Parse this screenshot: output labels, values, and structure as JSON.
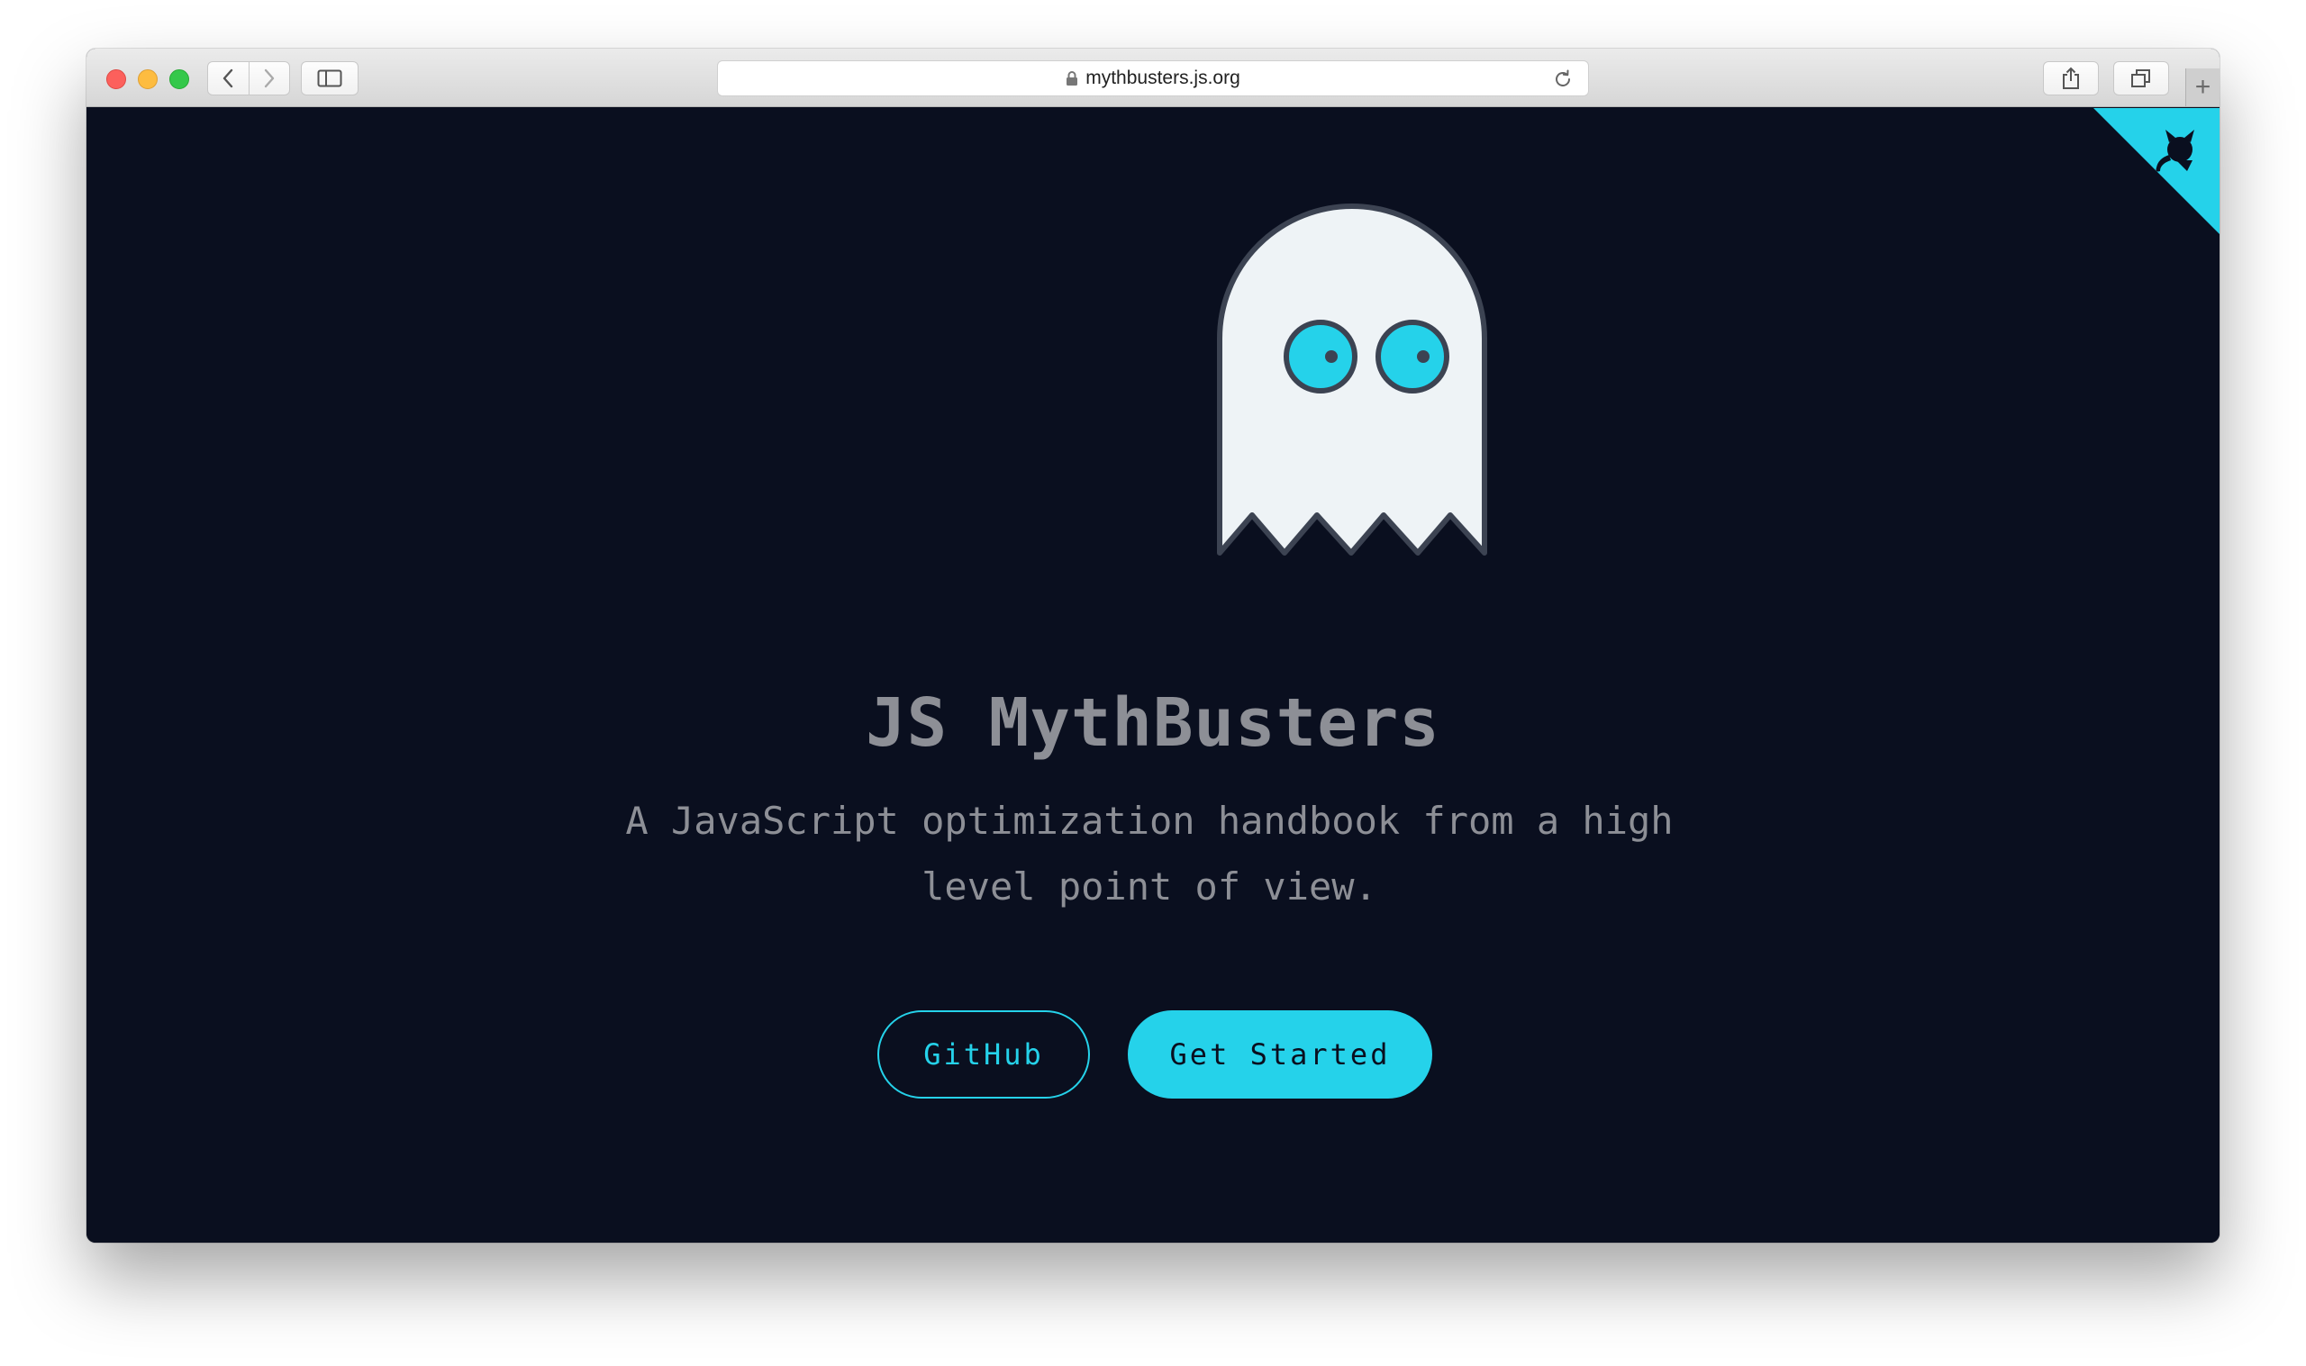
{
  "browser": {
    "url": "mythbusters.js.org",
    "newtab_label": "+"
  },
  "hero": {
    "title": "JS MythBusters",
    "tagline": "A JavaScript optimization handbook from a high level point of view."
  },
  "buttons": {
    "github_label": "GitHub",
    "start_label": "Get Started"
  },
  "colors": {
    "background": "#0a0f1f",
    "accent": "#25d2ea",
    "text": "#8d8f96",
    "ghost_body": "#eef3f6",
    "ghost_outline": "#3c4352"
  },
  "icons": {
    "corner": "github-octocat-icon",
    "logo": "ghost-logo"
  }
}
